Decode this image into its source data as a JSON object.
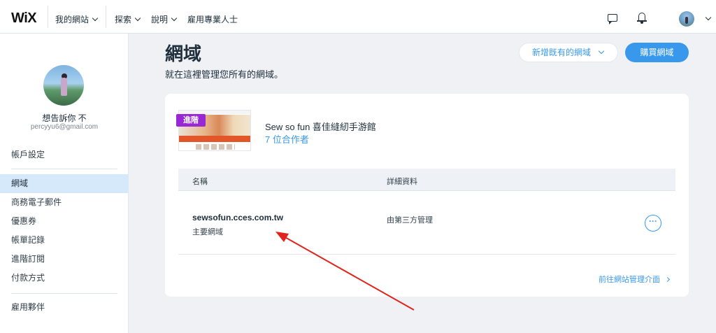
{
  "topbar": {
    "logo": "WiX",
    "my_sites": "我的網站",
    "explore": "探索",
    "help": "說明",
    "hire": "雇用專業人士"
  },
  "sidebar": {
    "user_name": "想告訴你 不",
    "user_email": "percyyu6@gmail.com",
    "items": [
      {
        "label": "帳戶設定"
      },
      {
        "label": "網域"
      },
      {
        "label": "商務電子郵件"
      },
      {
        "label": "優惠券"
      },
      {
        "label": "帳單記錄"
      },
      {
        "label": "進階訂閱"
      },
      {
        "label": "付款方式"
      },
      {
        "label": "雇用夥伴"
      }
    ]
  },
  "main": {
    "title": "網域",
    "subtitle": "就在這裡管理您所有的網域。",
    "add_existing_label": "新增既有的網域",
    "buy_label": "購買網域"
  },
  "site": {
    "badge": "進階",
    "name": "Sew so fun 喜佳縫紉手游館",
    "collaborators": "7 位合作者"
  },
  "table": {
    "col_name": "名稱",
    "col_details": "詳細資料",
    "rows": [
      {
        "domain": "sewsofun.cces.com.tw",
        "type": "主要網域",
        "detail": "由第三方管理",
        "action": "···"
      }
    ]
  },
  "footer_link": "前往網站管理介面",
  "colors": {
    "accent": "#3899ec",
    "badge": "#9a27d5",
    "annotation_arrow": "#e0241b"
  }
}
